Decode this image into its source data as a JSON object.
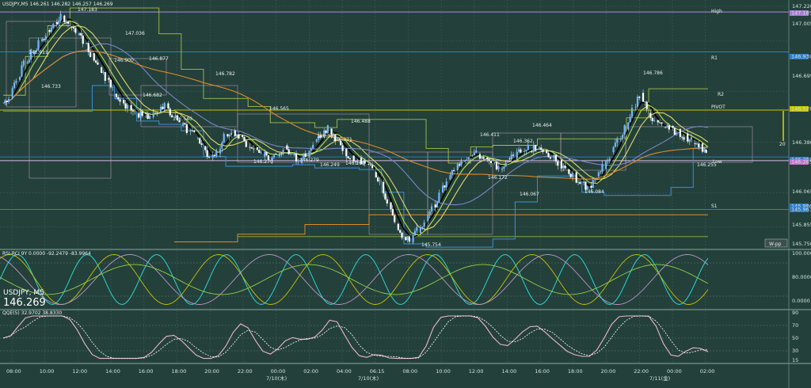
{
  "header": {
    "symbol_line": "USDJPY,M5 146.261 146.282 146.257 146.269",
    "rsi_title": "RSI-RCI 9Y 0.0000 -92.2479 -83.9964",
    "overlay_symbol": "USDJPY, M5",
    "overlay_price": "146.269",
    "qqe_title": "QQE(5) 32.9702 38.8330",
    "wpp_button": "W-pp"
  },
  "price_axis": {
    "labels": [
      "147.220",
      "147.005",
      "146.695",
      "146.380",
      "146.065",
      "145.855",
      "145.750"
    ],
    "tags": [
      {
        "text": "147.185",
        "color": "#a97ad6"
      },
      {
        "text": "146.938",
        "color": "#2e7fc8"
      },
      {
        "text": "146.578",
        "color": "#c8c400"
      },
      {
        "text": "146.288",
        "color": "#2e7fc8"
      },
      {
        "text": "146.265",
        "color": "#c86fd0"
      },
      {
        "text": "145.986",
        "color": "#2e7fc8"
      },
      {
        "text": "145.963",
        "color": "#2e7fc8"
      }
    ]
  },
  "pivot_labels": {
    "high": "High",
    "r1": "R1",
    "r2": "R2",
    "pivot": "PIVOT",
    "low": "Low",
    "s1": "S1",
    "range": "20"
  },
  "rsi_axis": [
    "100.0000",
    "80.0000",
    "0.0000"
  ],
  "qqe_axis": [
    "90",
    "70",
    "50",
    "30",
    "15"
  ],
  "time_axis": [
    "08:00",
    "10:00",
    "12:00",
    "14:00",
    "16:00",
    "18:00",
    "20:00",
    "22:00",
    "00:00",
    "02:00",
    "04:00",
    "06:15",
    "08:00",
    "10:00",
    "12:00",
    "14:00",
    "16:00",
    "18:00",
    "20:00",
    "22:00",
    "00:00",
    "02:00"
  ],
  "date_labels": [
    "7/10(木)",
    "7/10(木)",
    "7/11(金)"
  ],
  "chart_data": {
    "type": "candlestick",
    "symbol": "USDJPY",
    "timeframe": "M5",
    "price_labels": [
      {
        "text": "147.183",
        "value": 147.183
      },
      {
        "text": "147.036",
        "value": 147.036
      },
      {
        "text": "146.911",
        "value": 146.911
      },
      {
        "text": "146.900",
        "value": 146.9
      },
      {
        "text": "146.877",
        "value": 146.877
      },
      {
        "text": "146.733",
        "value": 146.733
      },
      {
        "text": "146.782",
        "value": 146.782
      },
      {
        "text": "146.682",
        "value": 146.682
      },
      {
        "text": "146.540",
        "value": 146.54
      },
      {
        "text": "146.565",
        "value": 146.565
      },
      {
        "text": "146.488",
        "value": 146.488
      },
      {
        "text": "146.382",
        "value": 146.382
      },
      {
        "text": "146.371",
        "value": 146.371
      },
      {
        "text": "146.270",
        "value": 146.27
      },
      {
        "text": "146.279",
        "value": 146.279
      },
      {
        "text": "146.249",
        "value": 146.249
      },
      {
        "text": "146.260",
        "value": 146.26
      },
      {
        "text": "146.411",
        "value": 146.411
      },
      {
        "text": "146.362",
        "value": 146.362
      },
      {
        "text": "146.464",
        "value": 146.464
      },
      {
        "text": "146.172",
        "value": 146.172
      },
      {
        "text": "146.067",
        "value": 146.067
      },
      {
        "text": "146.084",
        "value": 146.084
      },
      {
        "text": "146.786",
        "value": 146.786
      },
      {
        "text": "146.255",
        "value": 146.255
      },
      {
        "text": "145.754",
        "value": 145.754
      }
    ],
    "close_path": [
      146.62,
      146.66,
      146.78,
      146.86,
      146.93,
      146.99,
      147.05,
      147.11,
      147.16,
      147.12,
      147.06,
      147.0,
      146.93,
      146.86,
      146.78,
      146.7,
      146.64,
      146.59,
      146.56,
      146.54,
      146.55,
      146.58,
      146.6,
      146.55,
      146.5,
      146.46,
      146.42,
      146.34,
      146.28,
      146.33,
      146.41,
      146.45,
      146.42,
      146.37,
      146.33,
      146.3,
      146.29,
      146.31,
      146.34,
      146.3,
      146.27,
      146.31,
      146.36,
      146.42,
      146.47,
      146.4,
      146.33,
      146.29,
      146.26,
      146.24,
      146.2,
      146.12,
      145.99,
      145.88,
      145.8,
      145.78,
      145.83,
      145.9,
      145.97,
      146.06,
      146.15,
      146.22,
      146.27,
      146.3,
      146.31,
      146.27,
      146.24,
      146.22,
      146.26,
      146.3,
      146.32,
      146.34,
      146.35,
      146.32,
      146.29,
      146.25,
      146.21,
      146.17,
      146.12,
      146.1,
      146.15,
      146.23,
      146.3,
      146.39,
      146.48,
      146.59,
      146.66,
      146.58,
      146.5,
      146.47,
      146.46,
      146.44,
      146.41,
      146.39,
      146.36,
      146.3
    ],
    "highlight_ranges": {
      "upper": 147.22,
      "lower": 145.75
    },
    "moving_averages": [
      {
        "color": "#000000"
      },
      {
        "color": "#b7e04a"
      },
      {
        "color": "#e0d870"
      },
      {
        "color": "#7a86c8"
      },
      {
        "color": "#e08a2a"
      }
    ],
    "pivot_lines": [
      {
        "label": "High",
        "value": 147.185,
        "color": "#b28ad8"
      },
      {
        "label": "R1",
        "value": 146.938,
        "color": "#2e7fc8"
      },
      {
        "label": "PIVOT",
        "value": 146.578,
        "color": "#c8c400"
      },
      {
        "label": "S1",
        "value": 145.963,
        "color": "#2e7fc8"
      }
    ],
    "rsi_range": [
      0,
      100
    ],
    "qqe_range": [
      15,
      90
    ]
  }
}
